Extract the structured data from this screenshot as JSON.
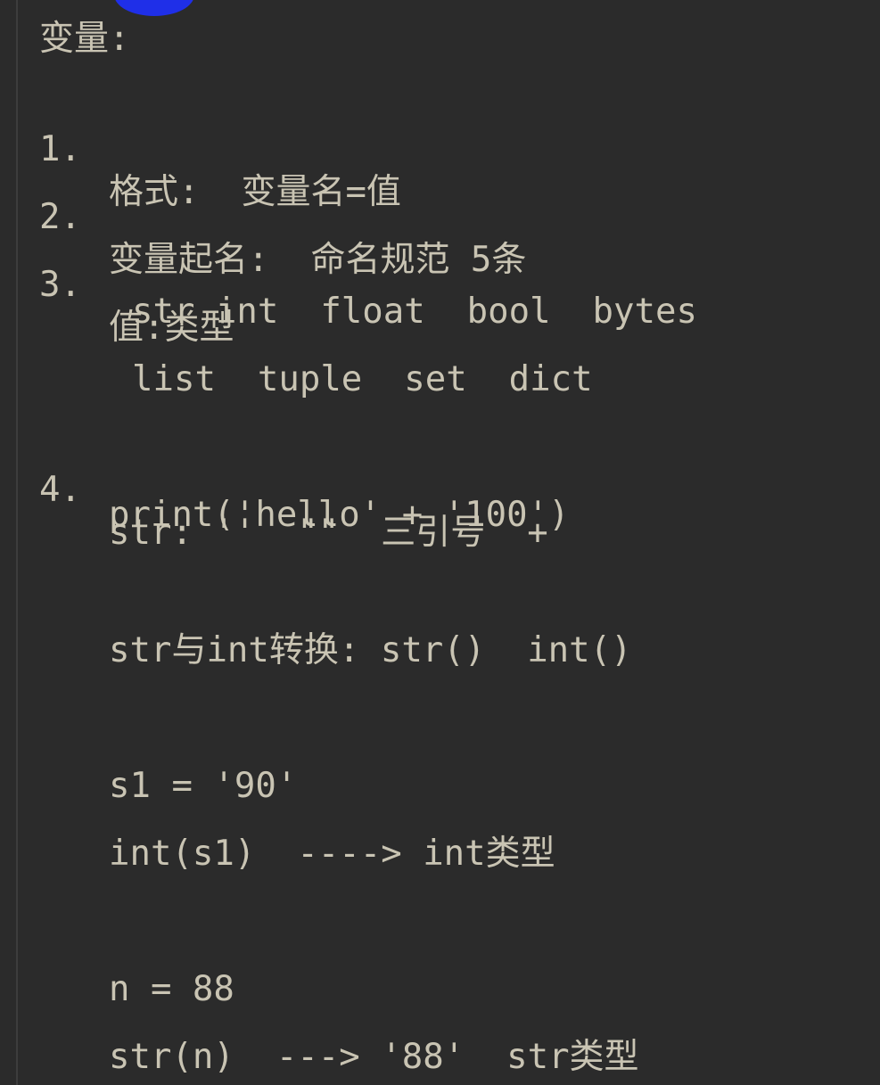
{
  "editor": {
    "title": "变量:",
    "items": [
      {
        "number": "1.",
        "text": "格式:  变量名=值"
      },
      {
        "number": "2.",
        "text": "变量起名:  命名规范 5条"
      },
      {
        "number": "3.",
        "text": "值:类型"
      }
    ],
    "types_line_1": "str int  float  bool  bytes",
    "types_line_2": "list  tuple  set  dict",
    "item4": {
      "number": "4.",
      "text": "str: ''  \"\"  三引号  +"
    },
    "print_line": "print('hello' + '100')",
    "convert_line": "str与int转换: str()  int()",
    "s1_assign": "s1 = '90'",
    "s1_convert": "int(s1)  ----> int类型",
    "n_assign": "n = 88",
    "n_convert": "str(n)  ---> '88'  str类型"
  },
  "colors": {
    "background": "#2b2b2b",
    "text": "#c9c4b3",
    "cursor": "#1f2fe8"
  }
}
